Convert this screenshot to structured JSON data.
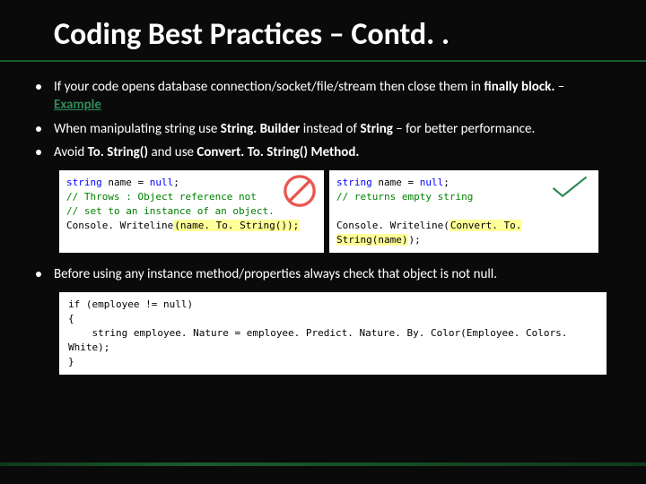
{
  "title": "Coding Best Practices – Contd. .",
  "bullets": {
    "b1_pre": "If your code opens database connection/socket/file/stream then close them in ",
    "b1_bold": "finally block.",
    "b1_dash": " – ",
    "b1_link": "Example",
    "b2_pre": "When manipulating string use ",
    "b2_bold1": "String. Builder",
    "b2_mid": " instead of ",
    "b2_bold2": "String ",
    "b2_post": "– for better performance.",
    "b3_pre": "Avoid ",
    "b3_bold1": "To. String()",
    "b3_mid": " and use ",
    "b3_bold2": "Convert. To. String() Method.",
    "b4": "Before using any instance method/properties always check that object is not null."
  },
  "code_left": {
    "l1_kw": "string",
    "l1_rest": " name = ",
    "l1_kw2": "null",
    "l1_end": ";",
    "l2": "// Throws : Object reference not",
    "l3": "// set to an instance of an object.",
    "l4a": "Console. Writeline",
    "l4_hl": "(name. To. String());"
  },
  "code_right": {
    "l1_kw": "string",
    "l1_rest": " name = ",
    "l1_kw2": "null",
    "l1_end": ";",
    "l2": "// returns empty string",
    "l3a": "Console. Writeline(",
    "l3_hl": "Convert. To. String(name)",
    "l3b": ");"
  },
  "code_bottom": {
    "l1_kw": "if",
    "l1_rest": " (employee != ",
    "l1_kw2": "null",
    "l1_end": ")",
    "l2": "{",
    "l3_ind": "    ",
    "l3_kw": "string",
    "l3_rest": " employee. Nature = employee. Predict. Nature. By. Color(Employee. Colors. White);",
    "l4": "}"
  },
  "icons": {
    "bad": "no-entry-icon",
    "good": "check-icon"
  }
}
